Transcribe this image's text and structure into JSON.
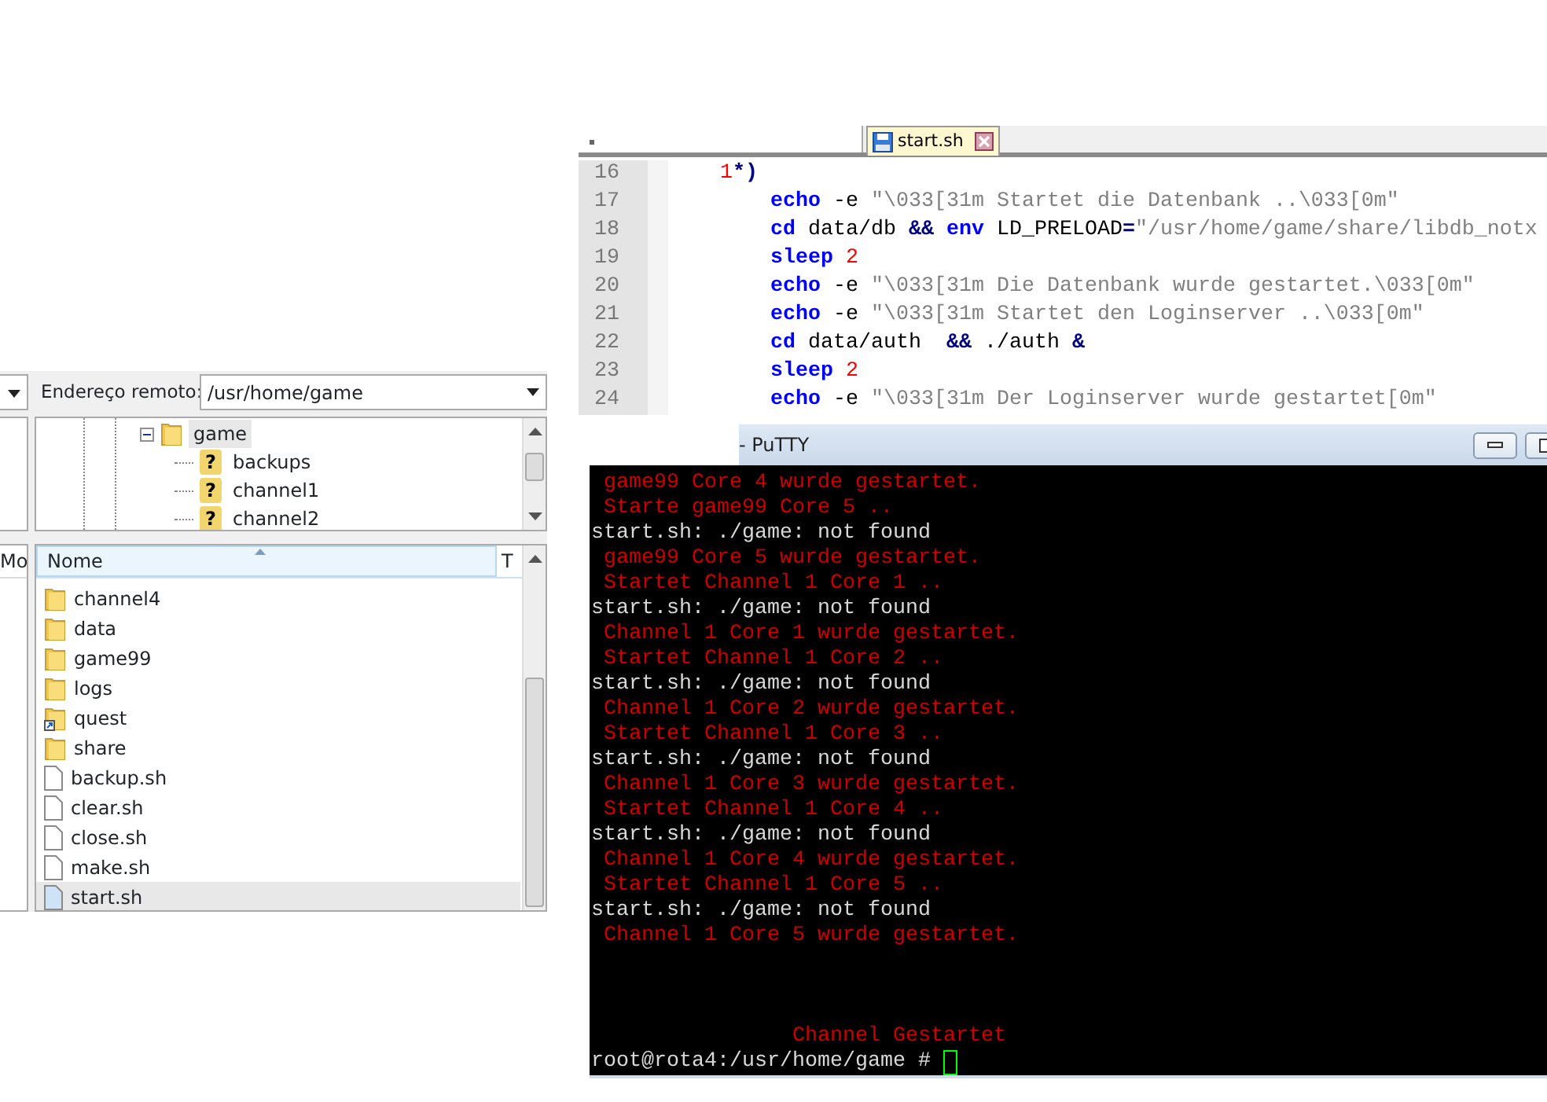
{
  "editor": {
    "tabs": [
      {
        "label": "start.sh",
        "selected": true
      }
    ],
    "lines": [
      {
        "number": "16",
        "kind": "case",
        "tokens": [
          {
            "kind": "number",
            "text": "1"
          },
          {
            "kind": "operator",
            "text": "*)"
          }
        ]
      },
      {
        "number": "17",
        "kind": "body",
        "tokens": [
          {
            "kind": "keyword",
            "text": "echo"
          },
          {
            "kind": "plain",
            "text": " -e "
          },
          {
            "kind": "string",
            "text": "\"\\033[31m Startet die Datenbank ..\\033[0m\""
          }
        ]
      },
      {
        "number": "18",
        "kind": "body",
        "tokens": [
          {
            "kind": "keyword",
            "text": "cd"
          },
          {
            "kind": "plain",
            "text": " data/db "
          },
          {
            "kind": "operator",
            "text": "&&"
          },
          {
            "kind": "keyword",
            "text": "env",
            "gap_before": true
          },
          {
            "kind": "plain",
            "text": " LD_PRELOAD"
          },
          {
            "kind": "operator",
            "text": "="
          },
          {
            "kind": "string",
            "text": "\"/usr/home/game/share/libdb_notx"
          }
        ]
      },
      {
        "number": "19",
        "kind": "body",
        "tokens": [
          {
            "kind": "keyword",
            "text": "sleep"
          },
          {
            "kind": "number",
            "text": "2",
            "gap_before": true
          }
        ]
      },
      {
        "number": "20",
        "kind": "body",
        "tokens": [
          {
            "kind": "keyword",
            "text": "echo"
          },
          {
            "kind": "plain",
            "text": " -e "
          },
          {
            "kind": "string",
            "text": "\"\\033[31m Die Datenbank wurde gestartet.\\033[0m\""
          }
        ]
      },
      {
        "number": "21",
        "kind": "body",
        "tokens": [
          {
            "kind": "keyword",
            "text": "echo"
          },
          {
            "kind": "plain",
            "text": " -e "
          },
          {
            "kind": "string",
            "text": "\"\\033[31m Startet den Loginserver ..\\033[0m\""
          }
        ]
      },
      {
        "number": "22",
        "kind": "body",
        "tokens": [
          {
            "kind": "keyword",
            "text": "cd"
          },
          {
            "kind": "plain",
            "text": " data/auth  "
          },
          {
            "kind": "operator",
            "text": "&&"
          },
          {
            "kind": "plain",
            "text": " ./auth "
          },
          {
            "kind": "operator",
            "text": "&"
          }
        ]
      },
      {
        "number": "23",
        "kind": "body",
        "tokens": [
          {
            "kind": "keyword",
            "text": "sleep"
          },
          {
            "kind": "number",
            "text": "2",
            "gap_before": true
          }
        ]
      },
      {
        "number": "24",
        "kind": "body",
        "tokens": [
          {
            "kind": "keyword",
            "text": "echo"
          },
          {
            "kind": "plain",
            "text": " -e "
          },
          {
            "kind": "string",
            "text": "\"\\033[31m Der Loginserver wurde gestartet[0m\""
          }
        ]
      }
    ]
  },
  "file_manager": {
    "local_column_header": "Mo",
    "remote_address_label": "Endereço remoto:",
    "remote_address": "/usr/home/game",
    "tree": [
      {
        "label": "game",
        "kind": "folder",
        "expanded": true,
        "selected": true,
        "children": [
          {
            "label": "backups",
            "kind": "unknown",
            "badge": "?",
            "selected": false
          },
          {
            "label": "channel1",
            "kind": "unknown",
            "badge": "?",
            "selected": false
          },
          {
            "label": "channel2",
            "kind": "unknown",
            "badge": "?",
            "selected": false
          }
        ]
      }
    ],
    "columns": [
      "Nome",
      "T"
    ],
    "files": [
      {
        "name": "channel4",
        "kind": "folder",
        "selected": false
      },
      {
        "name": "data",
        "kind": "folder",
        "selected": false
      },
      {
        "name": "game99",
        "kind": "folder",
        "selected": false
      },
      {
        "name": "logs",
        "kind": "folder",
        "selected": false
      },
      {
        "name": "quest",
        "kind": "link",
        "selected": false
      },
      {
        "name": "share",
        "kind": "folder",
        "selected": false
      },
      {
        "name": "backup.sh",
        "kind": "file",
        "selected": false
      },
      {
        "name": "clear.sh",
        "kind": "file",
        "selected": false
      },
      {
        "name": "close.sh",
        "kind": "file",
        "selected": false
      },
      {
        "name": "make.sh",
        "kind": "file",
        "selected": false
      },
      {
        "name": "start.sh",
        "kind": "file",
        "selected": true
      }
    ]
  },
  "terminal": {
    "title": "- PuTTY",
    "lines": [
      {
        "kind": "message",
        "text": "game99 Core 4 wurde gestartet."
      },
      {
        "kind": "message",
        "text": "Starte game99 Core 5 .."
      },
      {
        "kind": "output",
        "text": "start.sh: ./game: not found"
      },
      {
        "kind": "message",
        "text": "game99 Core 5 wurde gestartet."
      },
      {
        "kind": "message",
        "text": "Startet Channel 1 Core 1 .."
      },
      {
        "kind": "output",
        "text": "start.sh: ./game: not found"
      },
      {
        "kind": "message",
        "text": "Channel 1 Core 1 wurde gestartet."
      },
      {
        "kind": "message",
        "text": "Startet Channel 1 Core 2 .."
      },
      {
        "kind": "output",
        "text": "start.sh: ./game: not found"
      },
      {
        "kind": "message",
        "text": "Channel 1 Core 2 wurde gestartet."
      },
      {
        "kind": "message",
        "text": "Startet Channel 1 Core 3 .."
      },
      {
        "kind": "output",
        "text": "start.sh: ./game: not found"
      },
      {
        "kind": "message",
        "text": "Channel 1 Core 3 wurde gestartet."
      },
      {
        "kind": "message",
        "text": "Startet Channel 1 Core 4 .."
      },
      {
        "kind": "output",
        "text": "start.sh: ./game: not found"
      },
      {
        "kind": "message",
        "text": "Channel 1 Core 4 wurde gestartet."
      },
      {
        "kind": "message",
        "text": "Startet Channel 1 Core 5 .."
      },
      {
        "kind": "output",
        "text": "start.sh: ./game: not found"
      },
      {
        "kind": "message",
        "text": "Channel 1 Core 5 wurde gestartet."
      },
      {
        "kind": "banner",
        "text": "Channel Gestartet"
      }
    ],
    "prompt": "root@rota4:/usr/home/game #"
  }
}
